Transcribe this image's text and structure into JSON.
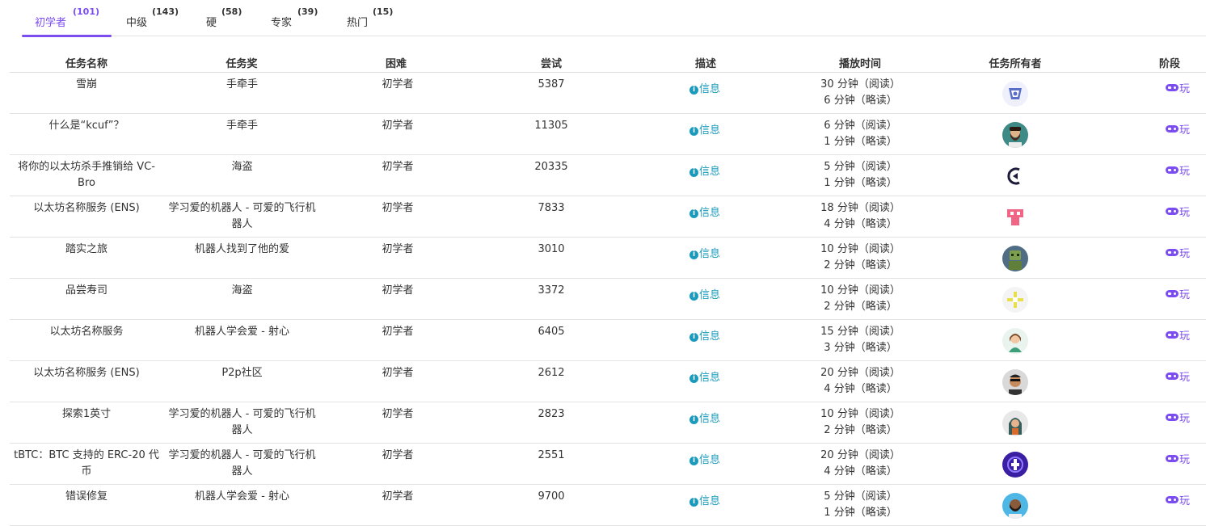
{
  "tabs": [
    {
      "label": "初学者",
      "count": "(101)",
      "active": true
    },
    {
      "label": "中级",
      "count": "(143)",
      "active": false
    },
    {
      "label": "硬",
      "count": "(58)",
      "active": false
    },
    {
      "label": "专家",
      "count": "(39)",
      "active": false
    },
    {
      "label": "热门",
      "count": "(15)",
      "active": false
    }
  ],
  "headers": {
    "name": "任务名称",
    "reward": "任务奖",
    "difficulty": "困难",
    "attempts": "尝试",
    "description": "描述",
    "playtime": "播放时间",
    "owner": "任务所有者",
    "stage": "阶段"
  },
  "rows": [
    {
      "name": "雪崩",
      "reward": "手牵手",
      "difficulty": "初学者",
      "attempts": "5387",
      "desc": "信息",
      "time_read": "30 分钟（阅读）",
      "time_skim": "6 分钟（略读）",
      "owner_icon": "avalanche-avatar-icon",
      "play": "玩"
    },
    {
      "name": "什么是“kcuf”？",
      "reward": "手牵手",
      "difficulty": "初学者",
      "attempts": "11305",
      "desc": "信息",
      "time_read": "6 分钟（阅读）",
      "time_skim": "1 分钟（略读）",
      "owner_icon": "bearded-man-avatar-icon",
      "play": "玩"
    },
    {
      "name": "将你的以太坊杀手推销给 VC-Bro",
      "reward": "海盗",
      "difficulty": "初学者",
      "attempts": "20335",
      "desc": "信息",
      "time_read": "5 分钟（阅读）",
      "time_skim": "1 分钟（略读）",
      "owner_icon": "crescent-logo-avatar-icon",
      "play": "玩"
    },
    {
      "name": "以太坊名称服务 (ENS)",
      "reward": "学习爱的机器人 - 可爱的飞行机器人",
      "difficulty": "初学者",
      "attempts": "7833",
      "desc": "信息",
      "time_read": "18 分钟（阅读）",
      "time_skim": "4 分钟（略读）",
      "owner_icon": "pink-pixel-avatar-icon",
      "play": "玩"
    },
    {
      "name": "踏实之旅",
      "reward": "机器人找到了他的爱",
      "difficulty": "初学者",
      "attempts": "3010",
      "desc": "信息",
      "time_read": "10 分钟（阅读）",
      "time_skim": "2 分钟（略读）",
      "owner_icon": "green-robot-avatar-icon",
      "play": "玩"
    },
    {
      "name": "品尝寿司",
      "reward": "海盗",
      "difficulty": "初学者",
      "attempts": "3372",
      "desc": "信息",
      "time_read": "10 分钟（阅读）",
      "time_skim": "2 分钟（略读）",
      "owner_icon": "yellow-pixel-avatar-icon",
      "play": "玩"
    },
    {
      "name": "以太坊名称服务",
      "reward": "机器人学会爱 - 射心",
      "difficulty": "初学者",
      "attempts": "6405",
      "desc": "信息",
      "time_read": "15 分钟（阅读）",
      "time_skim": "3 分钟（略读）",
      "owner_icon": "woman-avatar-icon",
      "play": "玩"
    },
    {
      "name": "以太坊名称服务 (ENS)",
      "reward": "P2p社区",
      "difficulty": "初学者",
      "attempts": "2612",
      "desc": "信息",
      "time_read": "20 分钟（阅读）",
      "time_skim": "4 分钟（略读）",
      "owner_icon": "sunglasses-man-avatar-icon",
      "play": "玩"
    },
    {
      "name": "探索1英寸",
      "reward": "学习爱的机器人 - 可爱的飞行机器人",
      "difficulty": "初学者",
      "attempts": "2823",
      "desc": "信息",
      "time_read": "10 分钟（阅读）",
      "time_skim": "2 分钟（略读）",
      "owner_icon": "hooded-man-avatar-icon",
      "play": "玩"
    },
    {
      "name": "tBTC：BTC 支持的 ERC-20 代币",
      "reward": "学习爱的机器人 - 可爱的飞行机器人",
      "difficulty": "初学者",
      "attempts": "2551",
      "desc": "信息",
      "time_read": "20 分钟（阅读）",
      "time_skim": "4 分钟（略读）",
      "owner_icon": "purple-logo-avatar-icon",
      "play": "玩"
    },
    {
      "name": "错误修复",
      "reward": "机器人学会爱 - 射心",
      "difficulty": "初学者",
      "attempts": "9700",
      "desc": "信息",
      "time_read": "5 分钟（阅读）",
      "time_skim": "1 分钟（略读）",
      "owner_icon": "blue-man-avatar-icon",
      "play": "玩"
    }
  ],
  "colors": {
    "accent": "#7b4cf0",
    "info": "#1a9bbd"
  }
}
